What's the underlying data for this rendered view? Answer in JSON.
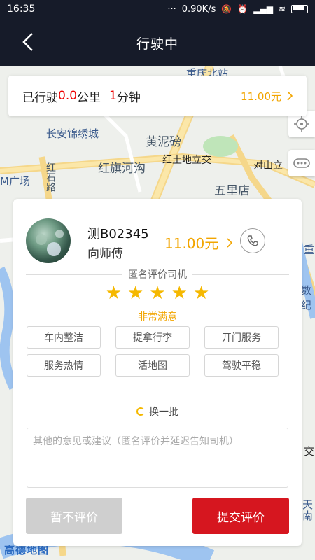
{
  "status_bar": {
    "time": "16:35",
    "dots": "···",
    "network_speed": "0.90K/s"
  },
  "header": {
    "title": "行驶中"
  },
  "map": {
    "labels": [
      "重庆北站",
      "长安锦绣城",
      "黄泥磅",
      "红旗河沟",
      "红土地立交",
      "对山立",
      "五里店",
      "红石路",
      "M广场",
      "重",
      "数纪",
      "交",
      "天",
      "南"
    ],
    "provider": "高德地图"
  },
  "trip": {
    "prefix": "已行驶",
    "distance": "0.0",
    "distance_unit": "公里",
    "minutes": "1",
    "minutes_unit": "分钟",
    "fare": "11.00元"
  },
  "driver": {
    "plate": "测B02345",
    "name": "向师傅",
    "fare": "11.00元"
  },
  "rating": {
    "section_title": "匿名评价司机",
    "stars": 5,
    "satisfaction": "非常满意",
    "tags": [
      "车内整洁",
      "提拿行李",
      "开门服务",
      "服务热情",
      "活地图",
      "驾驶平稳"
    ],
    "refresh_label": "换一批",
    "comment_placeholder": "其他的意见或建议（匿名评价并延迟告知司机）"
  },
  "actions": {
    "skip_label": "暂不评价",
    "submit_label": "提交评价"
  },
  "colors": {
    "accent": "#f2a500",
    "submit": "#d6161f",
    "header": "#161b29"
  }
}
